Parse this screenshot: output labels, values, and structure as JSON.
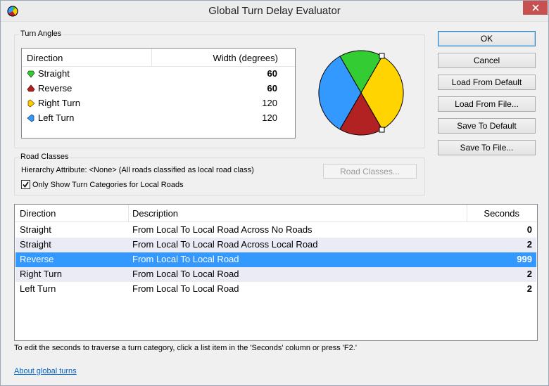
{
  "window": {
    "title": "Global Turn Delay Evaluator"
  },
  "turn_angles": {
    "group_label": "Turn Angles",
    "columns": [
      "Direction",
      "Width (degrees)"
    ],
    "rows": [
      {
        "direction": "Straight",
        "width": "60",
        "color": "#33cc33",
        "bold": true
      },
      {
        "direction": "Reverse",
        "width": "60",
        "color": "#b22222",
        "bold": true
      },
      {
        "direction": "Right Turn",
        "width": "120",
        "color": "#ffcc00",
        "bold": false
      },
      {
        "direction": "Left Turn",
        "width": "120",
        "color": "#3399ff",
        "bold": false
      }
    ]
  },
  "buttons": {
    "ok": "OK",
    "cancel": "Cancel",
    "load_default": "Load From Default",
    "load_file": "Load From File...",
    "save_default": "Save To Default",
    "save_file": "Save To File..."
  },
  "road_classes": {
    "group_label": "Road Classes",
    "hierarchy_text": "Hierarchy Attribute: <None> (All roads classified as local road class)",
    "button": "Road Classes...",
    "checkbox_label": "Only Show Turn Categories for Local Roads",
    "checkbox_checked": true
  },
  "delays": {
    "columns": [
      "Direction",
      "Description",
      "Seconds"
    ],
    "rows": [
      {
        "direction": "Straight",
        "description": "From Local To Local Road Across No Roads",
        "seconds": "0",
        "state": "normal"
      },
      {
        "direction": "Straight",
        "description": "From Local To Local Road Across Local Road",
        "seconds": "2",
        "state": "alt"
      },
      {
        "direction": "Reverse",
        "description": "From Local To Local Road",
        "seconds": "999",
        "state": "selected"
      },
      {
        "direction": "Right Turn",
        "description": "From Local To Local Road",
        "seconds": "2",
        "state": "alt"
      },
      {
        "direction": "Left Turn",
        "description": "From Local To Local Road",
        "seconds": "2",
        "state": "normal"
      }
    ]
  },
  "footer_note": "To edit the seconds to traverse a turn category, click a list item in the 'Seconds' column or press 'F2.'",
  "link_text": "About global turns",
  "colors": {
    "straight": "#33cc33",
    "reverse": "#b22222",
    "right": "#ffcc00",
    "left": "#3399ff",
    "selection": "#3399ff"
  }
}
